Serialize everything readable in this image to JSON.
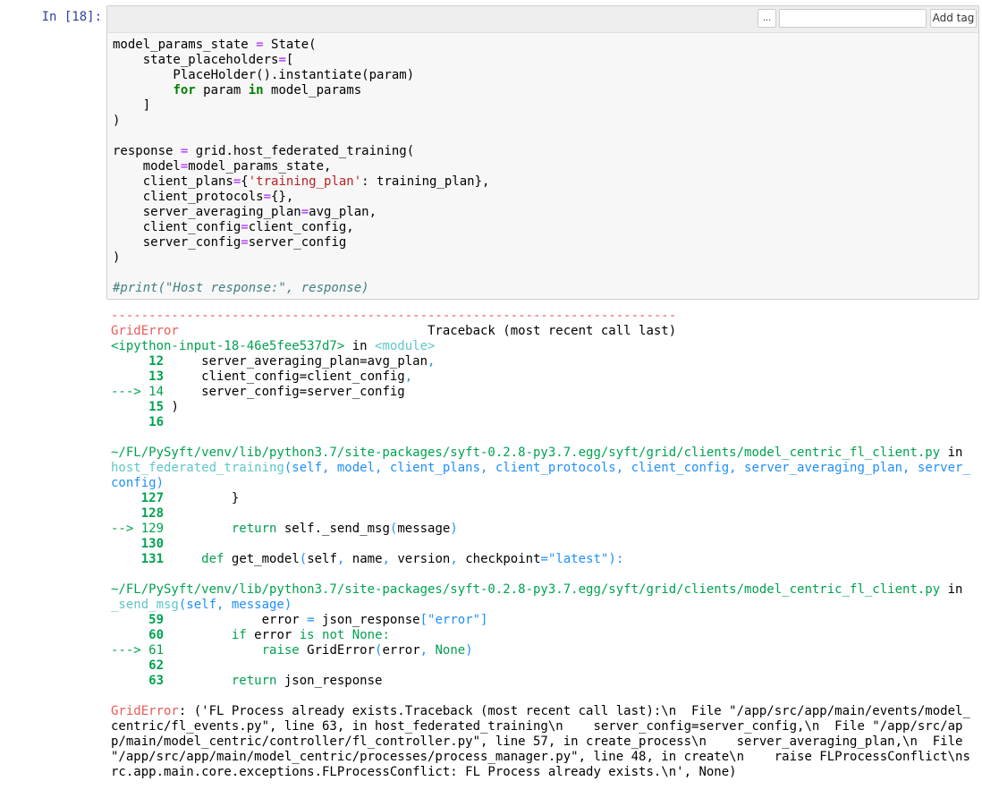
{
  "cell": {
    "prompt": "In [18]:",
    "toolbar": {
      "more_label": "...",
      "tag_input_value": "",
      "add_tag_label": "Add tag"
    },
    "code": [
      [
        [
          "t",
          "model_params_state "
        ],
        [
          "op",
          "="
        ],
        [
          "t",
          " State("
        ]
      ],
      [
        [
          "t",
          "    state_placeholders"
        ],
        [
          "op",
          "="
        ],
        [
          "t",
          "["
        ]
      ],
      [
        [
          "t",
          "        PlaceHolder().instantiate(param)"
        ]
      ],
      [
        [
          "t",
          "        "
        ],
        [
          "kw",
          "for"
        ],
        [
          "t",
          " param "
        ],
        [
          "kw",
          "in"
        ],
        [
          "t",
          " model_params"
        ]
      ],
      [
        [
          "t",
          "    ]"
        ]
      ],
      [
        [
          "t",
          ")"
        ]
      ],
      [
        [
          "t",
          ""
        ]
      ],
      [
        [
          "t",
          "response "
        ],
        [
          "op",
          "="
        ],
        [
          "t",
          " grid.host_federated_training("
        ]
      ],
      [
        [
          "t",
          "    model"
        ],
        [
          "op",
          "="
        ],
        [
          "t",
          "model_params_state,"
        ]
      ],
      [
        [
          "t",
          "    client_plans"
        ],
        [
          "op",
          "="
        ],
        [
          "t",
          "{"
        ],
        [
          "str",
          "'training_plan'"
        ],
        [
          "t",
          ": training_plan},"
        ]
      ],
      [
        [
          "t",
          "    client_protocols"
        ],
        [
          "op",
          "="
        ],
        [
          "t",
          "{},"
        ]
      ],
      [
        [
          "t",
          "    server_averaging_plan"
        ],
        [
          "op",
          "="
        ],
        [
          "t",
          "avg_plan,"
        ]
      ],
      [
        [
          "t",
          "    client_config"
        ],
        [
          "op",
          "="
        ],
        [
          "t",
          "client_config,"
        ]
      ],
      [
        [
          "t",
          "    server_config"
        ],
        [
          "op",
          "="
        ],
        [
          "t",
          "server_config"
        ]
      ],
      [
        [
          "t",
          ")"
        ]
      ],
      [
        [
          "t",
          ""
        ]
      ],
      [
        [
          "cm",
          "#print(\"Host response:\", response)"
        ]
      ]
    ]
  },
  "output": {
    "lines": [
      [
        [
          "r",
          "---------------------------------------------------------------------------"
        ]
      ],
      [
        [
          "r",
          "GridError"
        ],
        [
          "t",
          "                                 Traceback (most recent call last)"
        ]
      ],
      [
        [
          "g",
          "<ipython-input-18-46e5fee537d7>"
        ],
        [
          "t",
          " in "
        ],
        [
          "c",
          "<module>"
        ]
      ],
      [
        [
          "gb",
          "     12"
        ],
        [
          "t",
          "     server_averaging_plan"
        ],
        [
          "t",
          "=avg_plan"
        ],
        [
          "b",
          ","
        ]
      ],
      [
        [
          "gb",
          "     13"
        ],
        [
          "t",
          "     client_config"
        ],
        [
          "t",
          "=client_config"
        ],
        [
          "b",
          ","
        ]
      ],
      [
        [
          "g",
          "---> 14"
        ],
        [
          "t",
          "     server_config"
        ],
        [
          "t",
          "=server_config"
        ]
      ],
      [
        [
          "gb",
          "     15"
        ],
        [
          "t",
          " )"
        ]
      ],
      [
        [
          "gb",
          "     16"
        ]
      ],
      [
        [
          "t",
          ""
        ]
      ],
      [
        [
          "g",
          "~/FL/PySyft/venv/lib/python3.7/site-packages/syft-0.2.8-py3.7.egg/syft/grid/clients/model_centric_fl_client.py"
        ],
        [
          "t",
          " in"
        ]
      ],
      [
        [
          "c",
          "host_federated_training"
        ],
        [
          "b",
          "(self, model, client_plans, client_protocols, client_config, server_averaging_plan, server_"
        ]
      ],
      [
        [
          "b",
          "config)"
        ]
      ],
      [
        [
          "gb",
          "    127"
        ],
        [
          "t",
          "         }"
        ]
      ],
      [
        [
          "gb",
          "    128"
        ]
      ],
      [
        [
          "g",
          "--> 129"
        ],
        [
          "t",
          "         "
        ],
        [
          "g",
          "return"
        ],
        [
          "t",
          " self"
        ],
        [
          "t",
          "._send_msg"
        ],
        [
          "b",
          "("
        ],
        [
          "t",
          "message"
        ],
        [
          "b",
          ")"
        ]
      ],
      [
        [
          "gb",
          "    130"
        ]
      ],
      [
        [
          "gb",
          "    131"
        ],
        [
          "t",
          "     "
        ],
        [
          "g",
          "def"
        ],
        [
          "t",
          " get_model"
        ],
        [
          "b",
          "("
        ],
        [
          "t",
          "self"
        ],
        [
          "b",
          ", "
        ],
        [
          "t",
          "name"
        ],
        [
          "b",
          ", "
        ],
        [
          "t",
          "version"
        ],
        [
          "b",
          ", "
        ],
        [
          "t",
          "checkpoint"
        ],
        [
          "b",
          "=\"latest\"):"
        ]
      ],
      [
        [
          "t",
          ""
        ]
      ],
      [
        [
          "g",
          "~/FL/PySyft/venv/lib/python3.7/site-packages/syft-0.2.8-py3.7.egg/syft/grid/clients/model_centric_fl_client.py"
        ],
        [
          "t",
          " in"
        ]
      ],
      [
        [
          "c",
          "_send_msg"
        ],
        [
          "b",
          "(self, message)"
        ]
      ],
      [
        [
          "gb",
          "     59"
        ],
        [
          "t",
          "             error "
        ],
        [
          "b",
          "="
        ],
        [
          "t",
          " json_response"
        ],
        [
          "b",
          "[\"error\"]"
        ]
      ],
      [
        [
          "gb",
          "     60"
        ],
        [
          "t",
          "         "
        ],
        [
          "g",
          "if"
        ],
        [
          "t",
          " error "
        ],
        [
          "g",
          "is"
        ],
        [
          "t",
          " "
        ],
        [
          "g",
          "not"
        ],
        [
          "t",
          " "
        ],
        [
          "g",
          "None:"
        ]
      ],
      [
        [
          "g",
          "---> 61"
        ],
        [
          "t",
          "             "
        ],
        [
          "g",
          "raise"
        ],
        [
          "t",
          " GridError"
        ],
        [
          "b",
          "("
        ],
        [
          "t",
          "error"
        ],
        [
          "b",
          ", "
        ],
        [
          "g",
          "None"
        ],
        [
          "b",
          ")"
        ]
      ],
      [
        [
          "gb",
          "     62"
        ]
      ],
      [
        [
          "gb",
          "     63"
        ],
        [
          "t",
          "         "
        ],
        [
          "g",
          "return"
        ],
        [
          "t",
          " json_response"
        ]
      ],
      [
        [
          "t",
          ""
        ]
      ],
      [
        [
          "r",
          "GridError"
        ],
        [
          "t",
          ": ('FL Process already exists.Traceback (most recent call last):\\n  File \"/app/src/app/main/events/model_"
        ]
      ],
      [
        [
          "t",
          "centric/fl_events.py\", line 63, in host_federated_training\\n    server_config=server_config,\\n  File \"/app/src/ap"
        ]
      ],
      [
        [
          "t",
          "p/main/model_centric/controller/fl_controller.py\", line 57, in create_process\\n    server_averaging_plan,\\n  File"
        ]
      ],
      [
        [
          "t",
          "\"/app/src/app/main/model_centric/processes/process_manager.py\", line 48, in create\\n    raise FLProcessConflict\\ns"
        ]
      ],
      [
        [
          "t",
          "rc.app.main.core.exceptions.FLProcessConflict: FL Process already exists.\\n', None)"
        ]
      ]
    ]
  }
}
